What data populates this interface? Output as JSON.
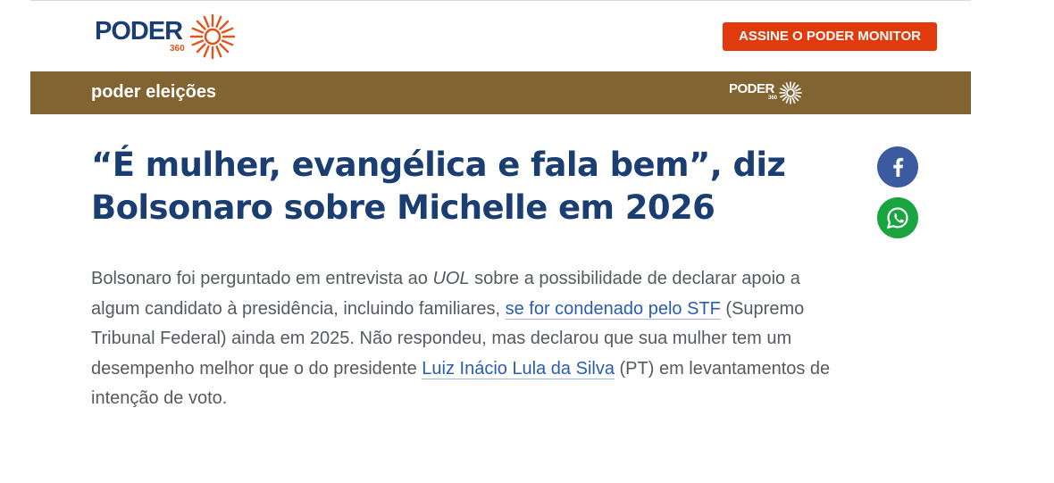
{
  "header": {
    "logo": {
      "word": "PODER",
      "number": "360"
    },
    "cta_label": "ASSINE O PODER MONITOR"
  },
  "section_bar": {
    "title": "poder eleições",
    "logo": {
      "word": "PODER",
      "number": "360"
    }
  },
  "article": {
    "headline_line1": "“É mulher, evangélica e fala bem”, diz",
    "headline_line2": "Bolsonaro sobre Michelle em 2026",
    "body": {
      "part1": "Bolsonaro foi perguntado em entrevista ao ",
      "outlet": "UOL",
      "part2": " sobre a possibilidade de declarar apoio a algum candidato à presidência, incluindo familiares, ",
      "link1": "se for condenado pelo STF",
      "part3": " (Supremo Tribunal Federal) ainda em 2025. Não respondeu, mas declarou que sua mulher tem um desempenho melhor que o do presidente ",
      "link2": "Luiz Inácio Lula da Silva",
      "part4": " (PT) em levantamentos de intenção de voto."
    }
  },
  "share": [
    {
      "network": "facebook",
      "icon": "facebook-icon",
      "color": "#3c5aa0"
    },
    {
      "network": "whatsapp",
      "icon": "whatsapp-icon",
      "color": "#1aa43f"
    }
  ],
  "colors": {
    "brand_blue": "#1a3e72",
    "brand_orange": "#e13a0c",
    "section_bar": "#826432",
    "link": "#2a5db0"
  }
}
